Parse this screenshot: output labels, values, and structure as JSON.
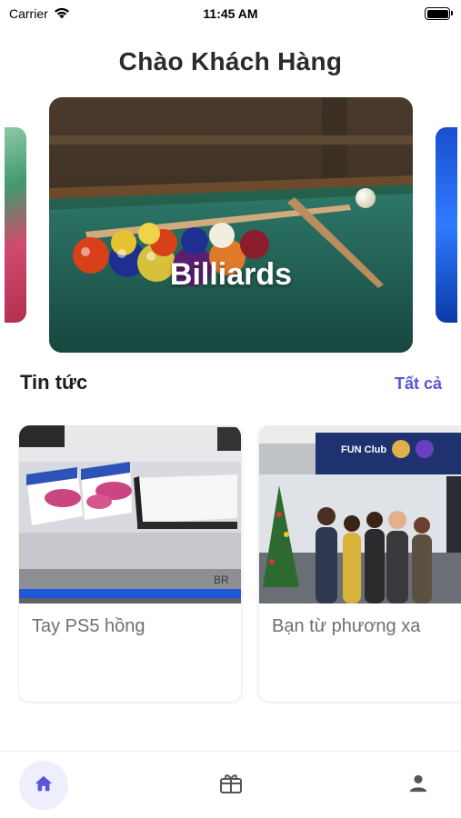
{
  "status_bar": {
    "carrier": "Carrier",
    "time": "11:45 AM"
  },
  "greeting": {
    "title": "Chào Khách Hàng"
  },
  "carousel": {
    "items": [
      {
        "label": ""
      },
      {
        "label": "Billiards"
      },
      {
        "label": ""
      }
    ]
  },
  "news": {
    "title": "Tin tức",
    "view_all": "Tất cả",
    "items": [
      {
        "caption": "Tay PS5 hồng"
      },
      {
        "caption": "Bạn từ phương xa"
      }
    ],
    "sign_text": "FUN Club"
  },
  "tab_bar": {
    "tabs": [
      {
        "icon": "home-icon",
        "active": true
      },
      {
        "icon": "gift-icon",
        "active": false
      },
      {
        "icon": "profile-icon",
        "active": false
      }
    ]
  },
  "colors": {
    "accent": "#5856d6",
    "active_tab_bg": "#eeeeff",
    "caption": "#6f6f6f"
  }
}
